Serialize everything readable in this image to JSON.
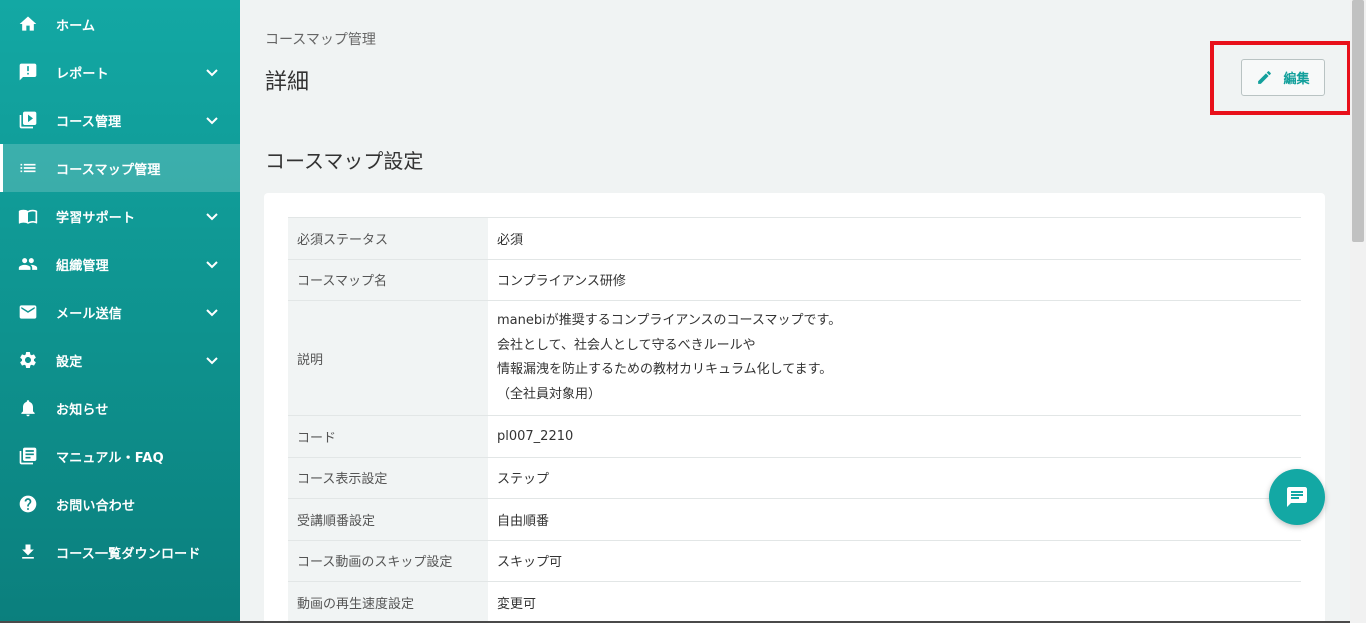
{
  "sidebar": {
    "items": [
      {
        "label": "ホーム",
        "icon": "home-icon",
        "has_submenu": false,
        "active": false
      },
      {
        "label": "レポート",
        "icon": "report-icon",
        "has_submenu": true,
        "active": false
      },
      {
        "label": "コース管理",
        "icon": "course-icon",
        "has_submenu": true,
        "active": false
      },
      {
        "label": "コースマップ管理",
        "icon": "list-icon",
        "has_submenu": false,
        "active": true
      },
      {
        "label": "学習サポート",
        "icon": "book-icon",
        "has_submenu": true,
        "active": false
      },
      {
        "label": "組織管理",
        "icon": "people-icon",
        "has_submenu": true,
        "active": false
      },
      {
        "label": "メール送信",
        "icon": "mail-icon",
        "has_submenu": true,
        "active": false
      },
      {
        "label": "設定",
        "icon": "gear-icon",
        "has_submenu": true,
        "active": false
      },
      {
        "label": "お知らせ",
        "icon": "bell-icon",
        "has_submenu": false,
        "active": false
      },
      {
        "label": "マニュアル・FAQ",
        "icon": "manual-icon",
        "has_submenu": false,
        "active": false
      },
      {
        "label": "お問い合わせ",
        "icon": "help-icon",
        "has_submenu": false,
        "active": false
      },
      {
        "label": "コース一覧ダウンロード",
        "icon": "download-icon",
        "has_submenu": false,
        "active": false
      }
    ]
  },
  "header": {
    "breadcrumb": "コースマップ管理",
    "title": "詳細",
    "edit_label": "編集"
  },
  "section": {
    "title": "コースマップ設定"
  },
  "settings": {
    "rows": [
      {
        "label": "必須ステータス",
        "value": "必須"
      },
      {
        "label": "コースマップ名",
        "value": "コンプライアンス研修"
      },
      {
        "label": "説明",
        "lines": [
          "manebiが推奨するコンプライアンスのコースマップです。",
          "会社として、社会人として守るべきルールや",
          "情報漏洩を防止するための教材カリキュラム化してます。",
          "（全社員対象用）"
        ]
      },
      {
        "label": "コード",
        "value": "pl007_2210"
      },
      {
        "label": "コース表示設定",
        "value": "ステップ"
      },
      {
        "label": "受講順番設定",
        "value": "自由順番"
      },
      {
        "label": "コース動画のスキップ設定",
        "value": "スキップ可"
      },
      {
        "label": "動画の再生速度設定",
        "value": "変更可"
      }
    ]
  },
  "colors": {
    "accent": "#13a8a4",
    "highlight": "#e8101a"
  }
}
